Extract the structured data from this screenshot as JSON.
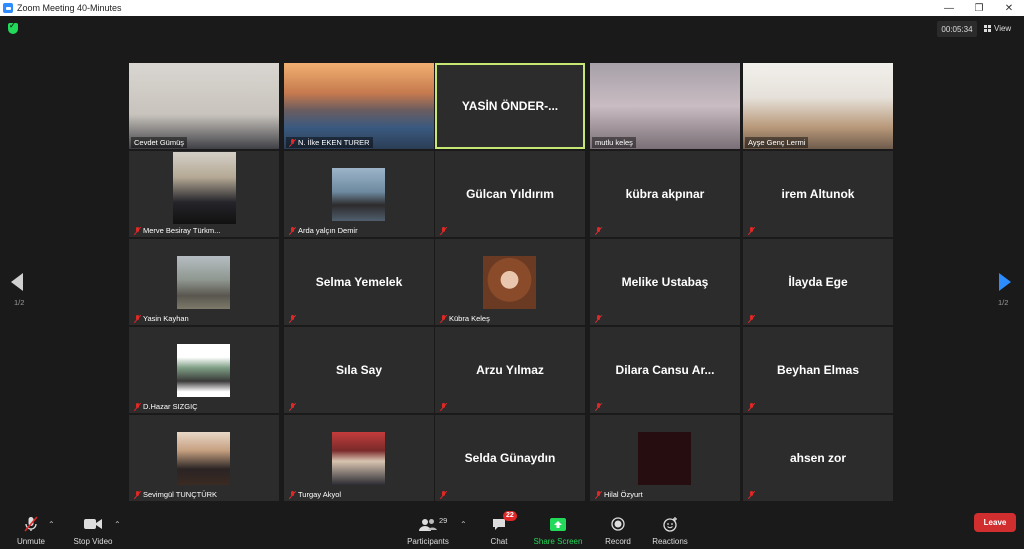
{
  "window": {
    "title": "Zoom Meeting 40-Minutes",
    "minimize": "—",
    "restore": "❐",
    "close": "✕"
  },
  "meeting": {
    "timer": "00:05:34",
    "view_label": "View"
  },
  "pager": {
    "left": "1/2",
    "right": "1/2"
  },
  "tiles": [
    {
      "name": "Cevdet Gümüş",
      "big": "",
      "muted": false
    },
    {
      "name": "N. İlke EKEN TURER",
      "big": "",
      "muted": true
    },
    {
      "name": "",
      "big": "YASİN ÖNDER-...",
      "muted": false
    },
    {
      "name": "mutlu keleş",
      "big": "",
      "muted": false
    },
    {
      "name": "Ayşe Genç Lermi",
      "big": "",
      "muted": false
    },
    {
      "name": "Merve Besiray Türkm...",
      "big": "",
      "muted": true
    },
    {
      "name": "Arda yalçın Demir",
      "big": "",
      "muted": true
    },
    {
      "name": "",
      "big": "Gülcan Yıldırım",
      "muted": true
    },
    {
      "name": "",
      "big": "kübra akpınar",
      "muted": true
    },
    {
      "name": "",
      "big": "irem Altunok",
      "muted": true
    },
    {
      "name": "Yasin Kayhan",
      "big": "",
      "muted": true
    },
    {
      "name": "",
      "big": "Selma Yemelek",
      "muted": true
    },
    {
      "name": "Kübra Keleş",
      "big": "",
      "muted": true
    },
    {
      "name": "",
      "big": "Melike Ustabaş",
      "muted": true
    },
    {
      "name": "",
      "big": "İlayda Ege",
      "muted": true
    },
    {
      "name": "D.Hazar SIZGIÇ",
      "big": "",
      "muted": true
    },
    {
      "name": "",
      "big": "Sıla Say",
      "muted": true
    },
    {
      "name": "",
      "big": "Arzu Yılmaz",
      "muted": true
    },
    {
      "name": "",
      "big": "Dilara  Cansu  Ar...",
      "muted": true
    },
    {
      "name": "",
      "big": "Beyhan Elmas",
      "muted": true
    },
    {
      "name": "Sevimgül TUNÇTÜRK",
      "big": "",
      "muted": true
    },
    {
      "name": "Turgay Akyol",
      "big": "",
      "muted": true
    },
    {
      "name": "",
      "big": "Selda Günaydın",
      "muted": true
    },
    {
      "name": "Hilal Özyurt",
      "big": "",
      "muted": true
    },
    {
      "name": "",
      "big": "ahsen zor",
      "muted": true
    }
  ],
  "toolbar": {
    "unmute": "Unmute",
    "stop_video": "Stop Video",
    "participants": "Participants",
    "participants_count": "29",
    "chat": "Chat",
    "chat_badge": "22",
    "share_screen": "Share Screen",
    "record": "Record",
    "reactions": "Reactions",
    "leave": "Leave"
  },
  "colors": {
    "share_green": "#23d959",
    "leave_red": "#d12f2f",
    "active_speaker": "#c6e773",
    "arrow_blue": "#2d8cff"
  }
}
